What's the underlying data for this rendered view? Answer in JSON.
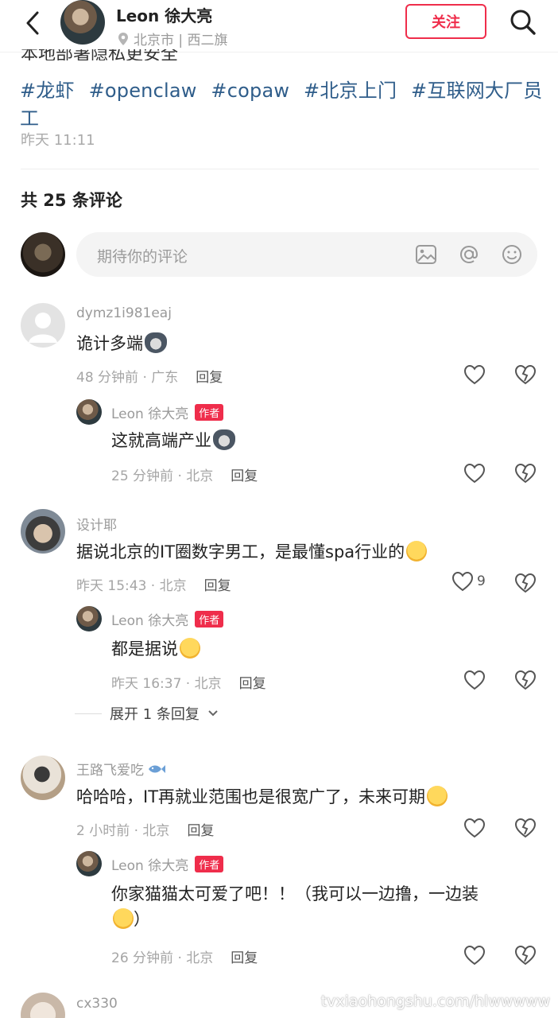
{
  "header": {
    "author_name": "Leon 徐大亮",
    "location": "北京市 | 西二旗",
    "follow_label": "关注"
  },
  "post": {
    "cut_text": "本地部署隐私更安全",
    "tags": [
      "#龙虾",
      "#openclaw",
      "#copaw",
      "#北京上门",
      "#互联网大厂员工"
    ],
    "time": "昨天 11:11"
  },
  "comments_section": {
    "count_label": "共 25 条评论",
    "input_placeholder": "期待你的评论"
  },
  "comments": [
    {
      "user": "dymz1i981eaj",
      "text": "诡计多端",
      "emoji": "cat-emoji",
      "time_loc": "48 分钟前 · 广东",
      "reply_label": "回复",
      "reply": {
        "user": "Leon 徐大亮",
        "badge": "作者",
        "text": "这就高端产业",
        "emoji": "cat-emoji",
        "time_loc": "25 分钟前 · 北京",
        "reply_label": "回复"
      }
    },
    {
      "user": "设计耶",
      "text": "据说北京的IT圈数字男工，是最懂spa行业的",
      "emoji": "laugh-cry-emoji",
      "time_loc": "昨天 15:43 · 北京",
      "reply_label": "回复",
      "likes": "9",
      "reply": {
        "user": "Leon 徐大亮",
        "badge": "作者",
        "text": "都是据说",
        "emoji": "grin-sweat-emoji",
        "time_loc": "昨天 16:37 · 北京",
        "reply_label": "回复"
      },
      "expand_label": "展开 1 条回复"
    },
    {
      "user": "王路飞爱吃",
      "text": "哈哈哈，IT再就业范围也是很宽广了，未来可期",
      "emoji": "shy-emoji",
      "time_loc": "2 小时前 · 北京",
      "reply_label": "回复",
      "reply": {
        "user": "Leon 徐大亮",
        "badge": "作者",
        "text_line1": "你家猫猫太可爱了吧！！（我可以一边撸，一边装",
        "text_line2": "）",
        "emoji": "grin-emoji",
        "time_loc": "26 分钟前 · 北京",
        "reply_label": "回复"
      }
    },
    {
      "user": "cx330"
    }
  ],
  "watermark": "tvxiaohongshu.com/hlwwwww",
  "colors": {
    "accent": "#ef2d4b",
    "tag_blue": "#2f5d8a",
    "muted": "#9a9a9a"
  }
}
